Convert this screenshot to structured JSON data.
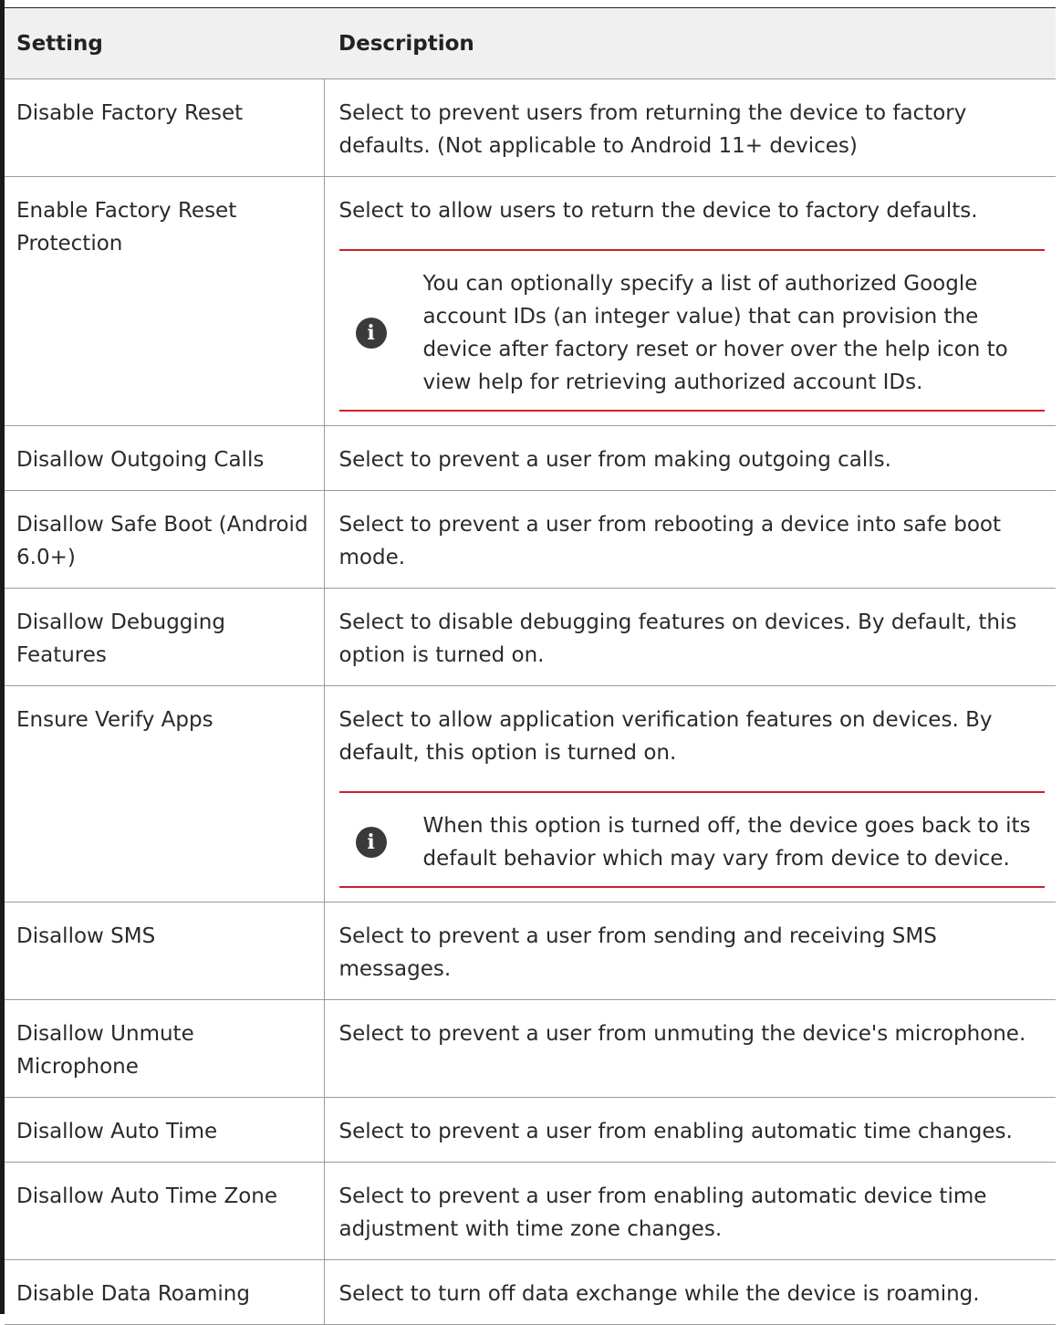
{
  "table": {
    "headers": {
      "setting": "Setting",
      "description": "Description"
    },
    "rows": [
      {
        "setting": "Disable Factory Reset",
        "description": "Select to prevent users from returning the device to factory defaults. (Not applicable to Android 11+ devices)"
      },
      {
        "setting": "Enable Factory Reset Protection",
        "description": "Select to allow users to return the device to factory defaults.",
        "note": "You can optionally specify a list of authorized Google account IDs (an integer value) that can provision the device after factory reset or hover over the help icon to view help for retrieving authorized account IDs."
      },
      {
        "setting": "Disallow Outgoing Calls",
        "description": "Select to prevent a user from making outgoing calls."
      },
      {
        "setting": "Disallow Safe Boot (Android 6.0+)",
        "description": "Select to prevent a user from rebooting a device into safe boot mode."
      },
      {
        "setting": "Disallow Debugging Features",
        "description": "Select to disable debugging features on devices. By default, this option is turned on."
      },
      {
        "setting": "Ensure Verify Apps",
        "description": "Select to allow application verification features on devices. By default, this option is turned on.",
        "note": "When this option is turned off, the device goes back to its default behavior which may vary from device to device."
      },
      {
        "setting": "Disallow SMS",
        "description": "Select to prevent a user from sending and receiving SMS messages."
      },
      {
        "setting": "Disallow Unmute Microphone",
        "description": "Select to prevent a user from unmuting the device's microphone."
      },
      {
        "setting": "Disallow Auto Time",
        "description": "Select to prevent a user from enabling automatic time changes."
      },
      {
        "setting": "Disallow Auto Time Zone",
        "description": "Select to prevent a user from enabling automatic device time adjustment with time zone changes."
      },
      {
        "setting": "Disable Data Roaming",
        "description": "Select to turn off data exchange while the device is roaming."
      }
    ]
  },
  "icons": {
    "note_icon": "info-icon",
    "note_glyph": "i"
  },
  "colors": {
    "note_rule": "#d0202a",
    "header_bg": "#f0f0f0",
    "icon_bg": "#3a3a3a"
  }
}
